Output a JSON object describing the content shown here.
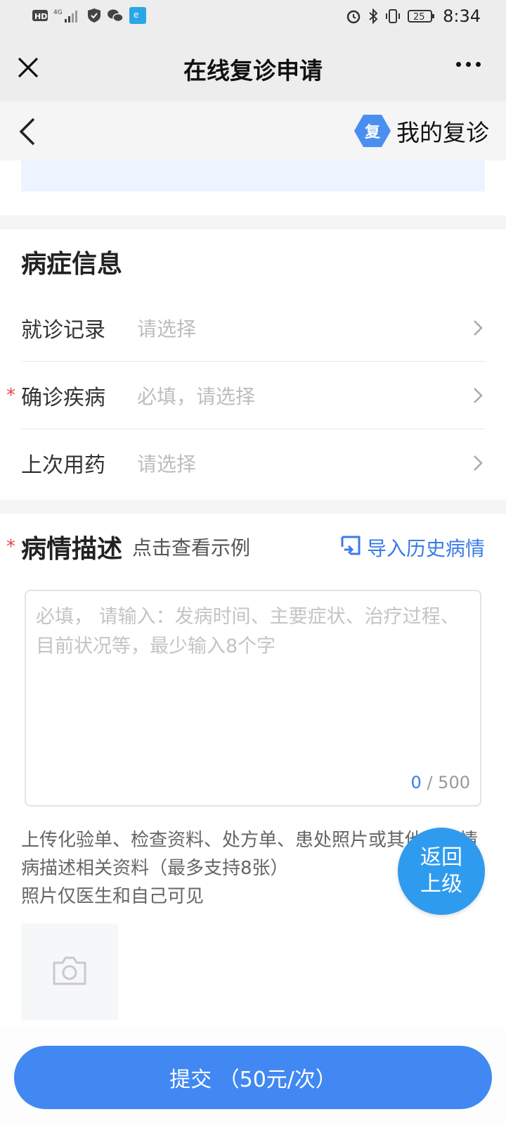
{
  "status_bar": {
    "network": "HD 4G",
    "battery": "25",
    "time": "8:34",
    "icons": [
      "hd-icon",
      "signal-icon",
      "shield-icon",
      "wechat-icon",
      "app-icon",
      "alarm-icon",
      "bluetooth-icon",
      "vibrate-icon",
      "battery-icon"
    ]
  },
  "nav": {
    "title": "在线复诊申请"
  },
  "sub_bar": {
    "badge": "复",
    "my_revisit": "我的复诊"
  },
  "disease_section": {
    "title": "病症信息",
    "rows": [
      {
        "label": "就诊记录",
        "placeholder": "请选择",
        "required": false
      },
      {
        "label": "确诊疾病",
        "placeholder": "必填，请选择",
        "required": true
      },
      {
        "label": "上次用药",
        "placeholder": "请选择",
        "required": false
      }
    ],
    "required_mark": "*"
  },
  "description": {
    "title": "病情描述",
    "example_link": "点击查看示例",
    "import_link": "导入历史病情",
    "placeholder": "必填， 请输入：发病时间、主要症状、治疗过程、目前状况等，最少输入8个字",
    "count_current": "0",
    "count_max": "/ 500"
  },
  "upload": {
    "hint_line1": "上传化验单、检查资料、处方单、患处照片或其他与病情",
    "hint_line2": "病描述相关资料（最多支持8张）",
    "hint_line3": "照片仅医生和自己可见"
  },
  "fab": {
    "line1": "返回",
    "line2": "上级"
  },
  "submit": {
    "label": "提交 （50元/次）"
  },
  "colors": {
    "accent": "#4188f2",
    "link": "#3a7be8",
    "required": "#e64545",
    "fab": "#2f9bef"
  }
}
